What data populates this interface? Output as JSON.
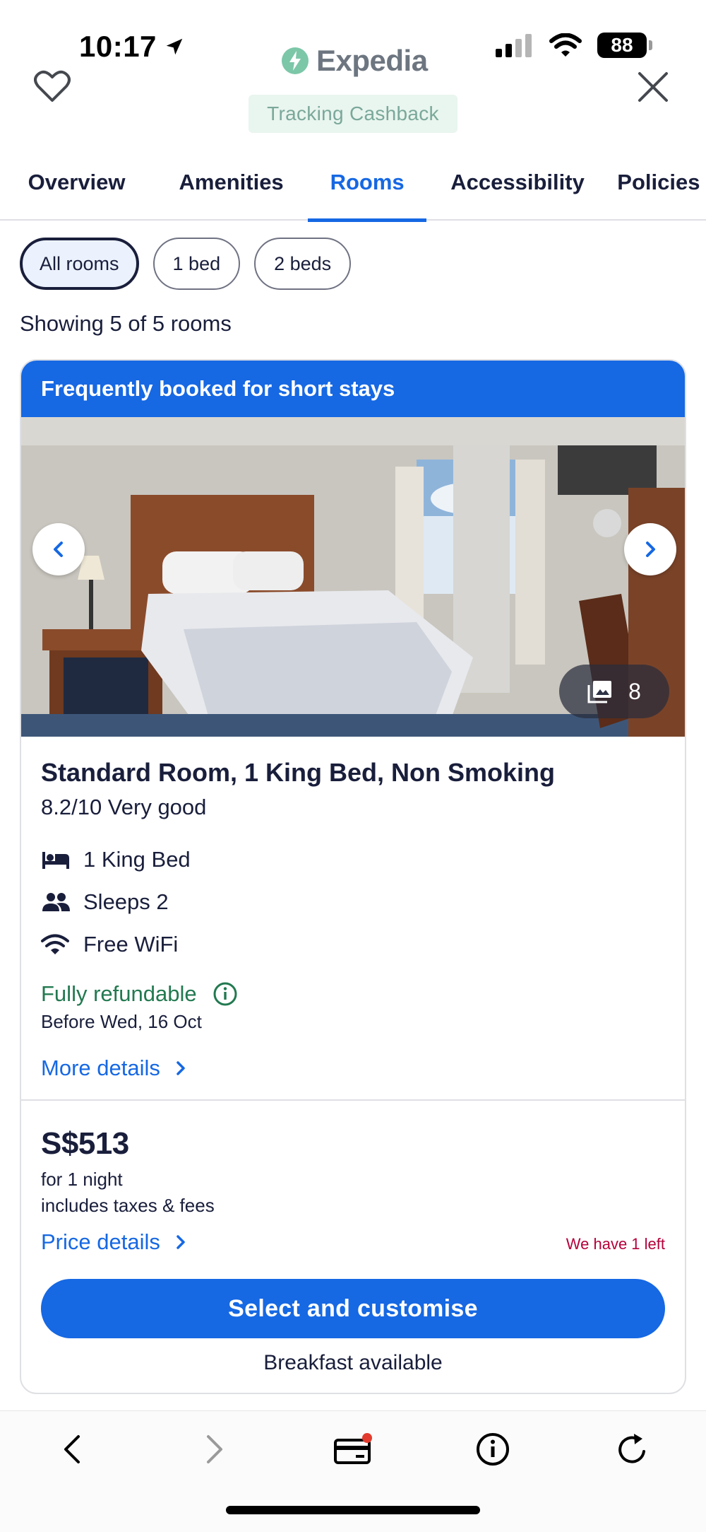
{
  "status_bar": {
    "time": "10:17",
    "battery": "88"
  },
  "header": {
    "brand": "Expedia",
    "cashback_label": "Tracking Cashback"
  },
  "tabs": [
    {
      "label": "Overview",
      "active": false
    },
    {
      "label": "Amenities",
      "active": false
    },
    {
      "label": "Rooms",
      "active": true
    },
    {
      "label": "Accessibility",
      "active": false
    },
    {
      "label": "Policies",
      "active": false
    }
  ],
  "filters": {
    "chips": [
      "All rooms",
      "1 bed",
      "2 beds"
    ],
    "selected": "All rooms"
  },
  "showing_text": "Showing 5 of 5 rooms",
  "room_card": {
    "banner": "Frequently booked for short stays",
    "photo_count": "8",
    "name": "Standard Room, 1 King Bed, Non Smoking",
    "rating": "8.2/10 Very good",
    "features": [
      {
        "icon": "bed-icon",
        "label": "1 King Bed"
      },
      {
        "icon": "people-icon",
        "label": "Sleeps 2"
      },
      {
        "icon": "wifi-icon",
        "label": "Free WiFi"
      }
    ],
    "refund_label": "Fully refundable",
    "refund_deadline": "Before Wed, 16 Oct",
    "more_details": "More details",
    "price": "S$513",
    "price_period": "for 1 night",
    "price_taxes": "includes taxes & fees",
    "price_details": "Price details",
    "availability_note": "We have 1 left",
    "select_button": "Select and customise",
    "breakfast": "Breakfast available"
  },
  "colors": {
    "accent": "#1668e3",
    "text": "#191e3b",
    "refund_green": "#227950",
    "alert_red": "#b5003a"
  }
}
